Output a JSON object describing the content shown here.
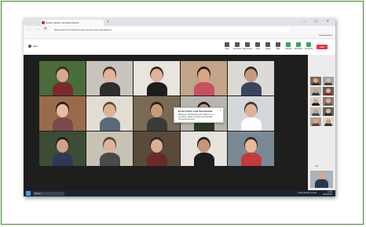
{
  "browser": {
    "tab_title": "Sesión Sesión Formativa Estrat...",
    "new_tab": "+",
    "window_controls": "— ▢ ✕",
    "nav_buttons": "← → ⟳",
    "url": "https://www.microsoft.com/es-es/microsoft-teams/log-in",
    "bookmarks": [
      "Inicio",
      "El Tiempo",
      "FrasDP",
      "Gmail",
      "RETOS SPORTING",
      "Office",
      "Fondos de ...",
      "Presidenta Ayto.",
      "SD Formadora Bada",
      "Restaurantes Re",
      "Tenerife Rosado",
      "Google ®",
      "Drive"
    ],
    "other_favorites": "Otros favoritos"
  },
  "meeting": {
    "room_label": "REC",
    "leave_label": "Salir",
    "toolbar": [
      "Chat",
      "Personas",
      "Reacciones",
      "Vista",
      "Notas",
      "Más",
      "Cámara",
      "Micrófono",
      "Compartir"
    ],
    "notification": {
      "title": "El micrófono está desactivado",
      "body": "Mantenga Ctrl+Espacio para hablar con el micrófono, pulsar y mantener presionado momentáneamente.",
      "close": "✕"
    },
    "tiles": [
      {
        "name": "",
        "bg": "#4a6b3a",
        "skin": "#d7a88c",
        "shirt": "#7a2a2a",
        "hair": "#3b2a20"
      },
      {
        "name": "",
        "bg": "#c9c4bd",
        "skin": "#e2b59b",
        "shirt": "#2d2d2d",
        "hair": "#4b3526"
      },
      {
        "name": "",
        "bg": "#e8e4de",
        "skin": "#e0b29a",
        "shirt": "#1d1d1d",
        "hair": "#3c2a1f"
      },
      {
        "name": "",
        "bg": "#c2a488",
        "skin": "#d9a585",
        "shirt": "#c85060",
        "hair": "#2a1d17"
      },
      {
        "name": "",
        "bg": "#dcdad5",
        "skin": "#c89a7c",
        "shirt": "#3a4560",
        "hair": "#2b2b2b"
      },
      {
        "name": "",
        "bg": "#9a6b4a",
        "skin": "#e6bda5",
        "shirt": "#7a4a4a",
        "hair": "#2a1f18"
      },
      {
        "name": "",
        "bg": "#e2ddd3",
        "skin": "#e0b197",
        "shirt": "#5a6a7a",
        "hair": "#6a4a30"
      },
      {
        "name": "",
        "bg": "#7a6a55",
        "skin": "#c99b7d",
        "shirt": "#3a3a3a",
        "hair": "#2b2218"
      },
      {
        "name": "",
        "bg": "#b8b5b0",
        "skin": "#c4977a",
        "shirt": "#2a3a2a",
        "hair": "#1e1e1e"
      },
      {
        "name": "",
        "bg": "#d4d8db",
        "skin": "#e0b298",
        "shirt": "#ffffff",
        "hair": "#3a3a3a"
      },
      {
        "name": "",
        "bg": "#3d4d35",
        "skin": "#d1a183",
        "shirt": "#2d3a55",
        "hair": "#1f1f1f"
      },
      {
        "name": "",
        "bg": "#c8c2b5",
        "skin": "#dfb39a",
        "shirt": "#4a4a4a",
        "hair": "#5a4433"
      },
      {
        "name": "",
        "bg": "#5a4a3a",
        "skin": "#dcae92",
        "shirt": "#6a2a2a",
        "hair": "#2a2a2a"
      },
      {
        "name": "",
        "bg": "#e6e2dc",
        "skin": "#c8957a",
        "shirt": "#1d1d1d",
        "hair": "#222222"
      },
      {
        "name": "",
        "bg": "#7a8a95",
        "skin": "#e6b99e",
        "shirt": "#c23a3a",
        "hair": "#3a2a20"
      }
    ]
  },
  "sidebar": {
    "pager": "1/2",
    "thumbs": [
      {
        "bg": "#7a6a5a",
        "skin": "#d9a98c",
        "shirt": "#333"
      },
      {
        "bg": "#9aa5b0",
        "skin": "#e0b69c",
        "shirt": "#444"
      },
      {
        "bg": "#b9b3a8",
        "skin": "#cf9e80",
        "shirt": "#2a3a55"
      },
      {
        "bg": "#6a5a4a",
        "skin": "#e1b49a",
        "shirt": "#7a2a2a"
      },
      {
        "bg": "#d8d2c8",
        "skin": "#d4a285",
        "shirt": "#1d1d1d"
      },
      {
        "bg": "#8a7a6a",
        "skin": "#deb095",
        "shirt": "#5a5a5a"
      },
      {
        "bg": "#c5c0b8",
        "skin": "#caa083",
        "shirt": "#3a4a5a"
      },
      {
        "bg": "#5a6a5a",
        "skin": "#e2b59b",
        "shirt": "#2a2a2a"
      },
      {
        "bg": "#b0a090",
        "skin": "#d6a688",
        "shirt": "#6a3a3a"
      },
      {
        "bg": "#d9d5ce",
        "skin": "#cf9d7f",
        "shirt": "#333"
      }
    ]
  },
  "taskbar": {
    "search_placeholder": "Buscar",
    "status_text": "Llega Naranjo la pulsa",
    "time": "12:05",
    "date": "20/04/2022",
    "icon_colors": [
      "#e8b33a",
      "#4a9ce8",
      "#3aa655",
      "#d9303e",
      "#7a5ae8",
      "#e8743a",
      "#4ac8e8",
      "#aaaaaa"
    ]
  }
}
